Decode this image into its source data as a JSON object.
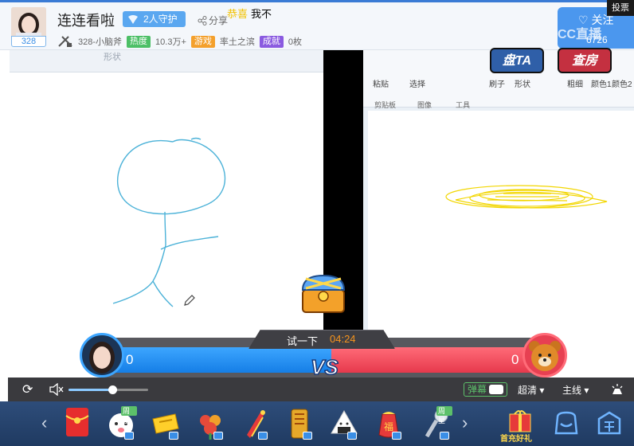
{
  "header": {
    "title": "连连看啦",
    "fans_count": "328",
    "guard_label": "2人守护",
    "share_label": "分享",
    "meta": {
      "anchor_id": "328-小脑斧",
      "heat_tag": "热度",
      "heat_value": "10.3万+",
      "category_tag": "游戏",
      "category_value": "率土之滨",
      "achievement_tag": "成就",
      "achievement_value": "0枚"
    },
    "follow_label": "关注",
    "follow_count": "6726",
    "watermark": "CC直播",
    "vote_label": "投票"
  },
  "stream": {
    "left_strip_label": "形状",
    "congrats_highlight": "恭喜",
    "congrats_text": "我不",
    "ribbon": {
      "items": [
        "粘贴",
        "选择",
        "刷子",
        "形状",
        "粗细",
        "颜色1",
        "颜色2"
      ],
      "groups": [
        "剪贴板",
        "图像",
        "工具"
      ]
    },
    "action_buttons": [
      "盘TA",
      "查房"
    ]
  },
  "pk": {
    "try_label": "试一下",
    "timer": "04:24",
    "left_score": "0",
    "right_score": "0",
    "vs_label": "VS",
    "left_color": "#1e8af0",
    "right_color": "#ec4a5c"
  },
  "controls": {
    "volume": 0.55,
    "danmu_label": "弹幕",
    "quality_label": "超清",
    "line_label": "主线"
  },
  "gifts": {
    "items": [
      {
        "name": "red-envelope",
        "badge": ""
      },
      {
        "name": "cute-face",
        "badge": "周星"
      },
      {
        "name": "ticket",
        "badge": ""
      },
      {
        "name": "flower",
        "badge": ""
      },
      {
        "name": "rocket",
        "badge": ""
      },
      {
        "name": "golden-scroll",
        "badge": ""
      },
      {
        "name": "rice-ball",
        "badge": ""
      },
      {
        "name": "lucky-bag",
        "badge": ""
      },
      {
        "name": "microphone",
        "badge": "周星"
      }
    ],
    "first_charge_label": "首充好礼"
  }
}
